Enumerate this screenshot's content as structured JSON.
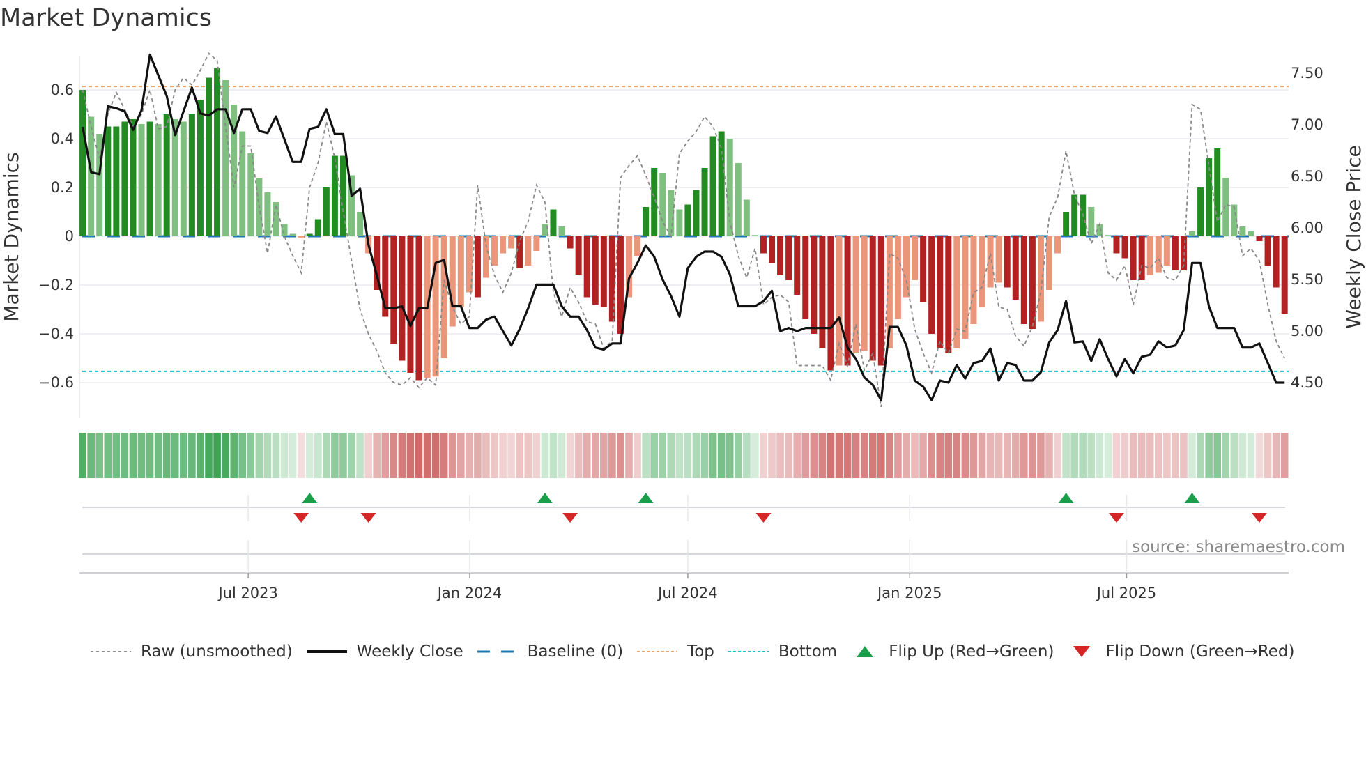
{
  "title": "Market Dynamics",
  "source": "source: sharemaestro.com",
  "legend": {
    "raw": "Raw (unsmoothed)",
    "close": "Weekly Close",
    "baseline": "Baseline (0)",
    "top": "Top",
    "bottom": "Bottom",
    "flip_up": "Flip Up (Red→Green)",
    "flip_down": "Flip Down (Green→Red)"
  },
  "colors": {
    "strong_green": "#228b22",
    "weak_green": "#7fbf7f",
    "strong_red": "#b22222",
    "weak_red": "#e9967a",
    "close": "#111111",
    "raw": "#888888",
    "baseline": "#1f77b4",
    "top": "#f4a261",
    "bottom": "#17becf",
    "flip_up": "#1a9e4a",
    "flip_down": "#d62728"
  },
  "chart_data": {
    "type": "bar",
    "title": "Market Dynamics",
    "xlabel": "",
    "ylabel": "Market Dynamics",
    "ylabel_right": "Weekly Close Price",
    "ylim": [
      -0.74,
      0.74
    ],
    "ylim_right": [
      4.02,
      7.8
    ],
    "y_ticks": [
      {
        "v": 0.6,
        "label": "0.6"
      },
      {
        "v": 0.4,
        "label": "0.4"
      },
      {
        "v": 0.2,
        "label": "0.2"
      },
      {
        "v": 0,
        "label": "0"
      },
      {
        "v": -0.2,
        "label": "−0.2"
      },
      {
        "v": -0.4,
        "label": "−0.4"
      },
      {
        "v": -0.6,
        "label": "−0.6"
      }
    ],
    "y_ticks_right": [
      {
        "v": 4.5,
        "label": "4.50"
      },
      {
        "v": 5.0,
        "label": "5.00"
      },
      {
        "v": 5.5,
        "label": "5.50"
      },
      {
        "v": 6.0,
        "label": "6.00"
      },
      {
        "v": 6.5,
        "label": "6.50"
      },
      {
        "v": 7.0,
        "label": "7.00"
      },
      {
        "v": 7.5,
        "label": "7.50"
      }
    ],
    "x_ticks": [
      {
        "week": 20.7,
        "label": "Jul 2023"
      },
      {
        "week": 47.05,
        "label": "Jan 2024"
      },
      {
        "week": 73.0,
        "label": "Jul 2024"
      },
      {
        "week": 99.4,
        "label": "Jan 2025"
      },
      {
        "week": 125.2,
        "label": "Jul 2025"
      }
    ],
    "top_level": 0.614,
    "bottom_level": -0.554,
    "baseline": 0,
    "series": [
      {
        "name": "Market Dynamics (smoothed)",
        "type": "bar",
        "values": [
          0.6,
          0.49,
          0.42,
          0.45,
          0.45,
          0.47,
          0.48,
          0.46,
          0.47,
          0.46,
          0.5,
          0.48,
          0.47,
          0.5,
          0.56,
          0.65,
          0.69,
          0.64,
          0.54,
          0.43,
          0.34,
          0.24,
          0.18,
          0.14,
          0.05,
          0.01,
          -0.005,
          0.01,
          0.07,
          0.2,
          0.33,
          0.33,
          0.25,
          0.1,
          -0.07,
          -0.22,
          -0.33,
          -0.44,
          -0.51,
          -0.56,
          -0.59,
          -0.58,
          -0.575,
          -0.5,
          -0.37,
          -0.29,
          -0.23,
          -0.25,
          -0.17,
          -0.12,
          -0.07,
          -0.05,
          -0.13,
          -0.12,
          -0.06,
          0.05,
          0.11,
          0.04,
          -0.05,
          -0.16,
          -0.25,
          -0.28,
          -0.29,
          -0.35,
          -0.4,
          -0.25,
          -0.08,
          0.12,
          0.28,
          0.26,
          0.19,
          0.11,
          0.13,
          0.19,
          0.28,
          0.41,
          0.43,
          0.4,
          0.3,
          0.15,
          0.005,
          -0.07,
          -0.11,
          -0.16,
          -0.18,
          -0.24,
          -0.34,
          -0.4,
          -0.46,
          -0.55,
          -0.53,
          -0.53,
          -0.48,
          -0.47,
          -0.51,
          -0.53,
          -0.46,
          -0.34,
          -0.25,
          -0.18,
          -0.27,
          -0.4,
          -0.46,
          -0.48,
          -0.46,
          -0.42,
          -0.36,
          -0.29,
          -0.21,
          -0.19,
          -0.21,
          -0.26,
          -0.36,
          -0.38,
          -0.35,
          -0.22,
          -0.07,
          0.1,
          0.17,
          0.17,
          0.12,
          0.05,
          0.005,
          -0.07,
          -0.09,
          -0.18,
          -0.18,
          -0.16,
          -0.15,
          -0.12,
          -0.14,
          -0.14,
          0.02,
          0.2,
          0.32,
          0.36,
          0.24,
          0.13,
          0.04,
          0.02,
          -0.02,
          -0.12,
          -0.21,
          -0.32
        ]
      },
      {
        "name": "Raw (unsmoothed)",
        "type": "line",
        "values": [
          0.6,
          0.45,
          0.32,
          0.5,
          0.59,
          0.52,
          0.45,
          0.5,
          0.6,
          0.44,
          0.45,
          0.6,
          0.65,
          0.62,
          0.68,
          0.75,
          0.72,
          0.45,
          0.2,
          0.37,
          0.37,
          0.12,
          -0.07,
          0.13,
          0.0,
          -0.08,
          -0.15,
          0.2,
          0.3,
          0.47,
          0.32,
          0.1,
          -0.1,
          -0.3,
          -0.4,
          -0.47,
          -0.56,
          -0.6,
          -0.61,
          -0.58,
          -0.62,
          -0.58,
          -0.61,
          -0.18,
          -0.29,
          -0.36,
          -0.33,
          0.21,
          -0.04,
          -0.16,
          -0.23,
          -0.15,
          -0.02,
          0.06,
          0.21,
          0.14,
          -0.23,
          -0.33,
          -0.21,
          -0.27,
          -0.35,
          -0.36,
          -0.46,
          -0.43,
          0.24,
          0.29,
          0.33,
          0.25,
          0.16,
          0.06,
          0.0,
          0.34,
          0.39,
          0.43,
          0.49,
          0.45,
          0.36,
          0.06,
          -0.08,
          -0.17,
          -0.05,
          -0.28,
          -0.25,
          -0.24,
          -0.27,
          -0.53,
          -0.53,
          -0.53,
          -0.53,
          -0.59,
          -0.44,
          -0.53,
          -0.36,
          -0.55,
          -0.48,
          -0.7,
          -0.07,
          -0.09,
          -0.18,
          -0.38,
          -0.48,
          -0.56,
          -0.43,
          -0.48,
          -0.38,
          -0.39,
          -0.23,
          -0.21,
          -0.07,
          -0.29,
          -0.3,
          -0.41,
          -0.45,
          -0.37,
          -0.23,
          0.08,
          0.16,
          0.35,
          0.17,
          0.09,
          -0.03,
          0.05,
          -0.15,
          -0.18,
          -0.12,
          -0.28,
          -0.12,
          -0.13,
          -0.09,
          -0.17,
          -0.18,
          -0.12,
          0.54,
          0.52,
          0.29,
          0.06,
          0.13,
          0.12,
          -0.08,
          -0.05,
          -0.1,
          -0.28,
          -0.43,
          -0.5
        ]
      },
      {
        "name": "Weekly Close",
        "type": "line",
        "axis": "right",
        "values": [
          6.98,
          6.54,
          6.52,
          7.18,
          7.16,
          7.13,
          6.95,
          7.14,
          7.68,
          7.48,
          7.28,
          6.9,
          7.13,
          7.36,
          7.11,
          7.09,
          7.15,
          7.15,
          6.92,
          7.15,
          7.15,
          6.94,
          6.92,
          7.08,
          6.86,
          6.64,
          6.64,
          6.96,
          6.98,
          7.15,
          6.91,
          6.91,
          6.31,
          6.38,
          5.84,
          5.54,
          5.22,
          5.22,
          5.24,
          5.05,
          5.22,
          5.22,
          5.66,
          5.69,
          5.24,
          5.24,
          5.03,
          5.03,
          5.11,
          5.14,
          5.0,
          4.86,
          5.02,
          5.22,
          5.45,
          5.45,
          5.45,
          5.24,
          5.14,
          5.14,
          5.01,
          4.84,
          4.82,
          4.88,
          4.88,
          5.51,
          5.66,
          5.83,
          5.72,
          5.5,
          5.34,
          5.14,
          5.61,
          5.72,
          5.77,
          5.77,
          5.72,
          5.55,
          5.24,
          5.24,
          5.24,
          5.29,
          5.39,
          5.0,
          5.03,
          5.0,
          5.03,
          5.03,
          5.03,
          5.03,
          5.13,
          4.84,
          4.73,
          4.55,
          4.48,
          4.33,
          5.04,
          5.04,
          4.86,
          4.52,
          4.46,
          4.33,
          4.52,
          4.5,
          4.67,
          4.54,
          4.69,
          4.71,
          4.83,
          4.52,
          4.69,
          4.67,
          4.52,
          4.52,
          4.6,
          4.89,
          5.01,
          5.29,
          4.89,
          4.9,
          4.71,
          4.92,
          4.73,
          4.56,
          4.73,
          4.59,
          4.75,
          4.77,
          4.9,
          4.84,
          4.86,
          5.01,
          5.66,
          5.66,
          5.24,
          5.03,
          5.03,
          5.03,
          4.84,
          4.84,
          4.88,
          4.69,
          4.5,
          4.5
        ]
      }
    ],
    "flips": {
      "up_weeks": [
        28,
        56,
        68,
        118,
        133
      ],
      "down_weeks": [
        27,
        35,
        59,
        82,
        124,
        141
      ]
    },
    "grid": true,
    "legend_position": "bottom"
  }
}
